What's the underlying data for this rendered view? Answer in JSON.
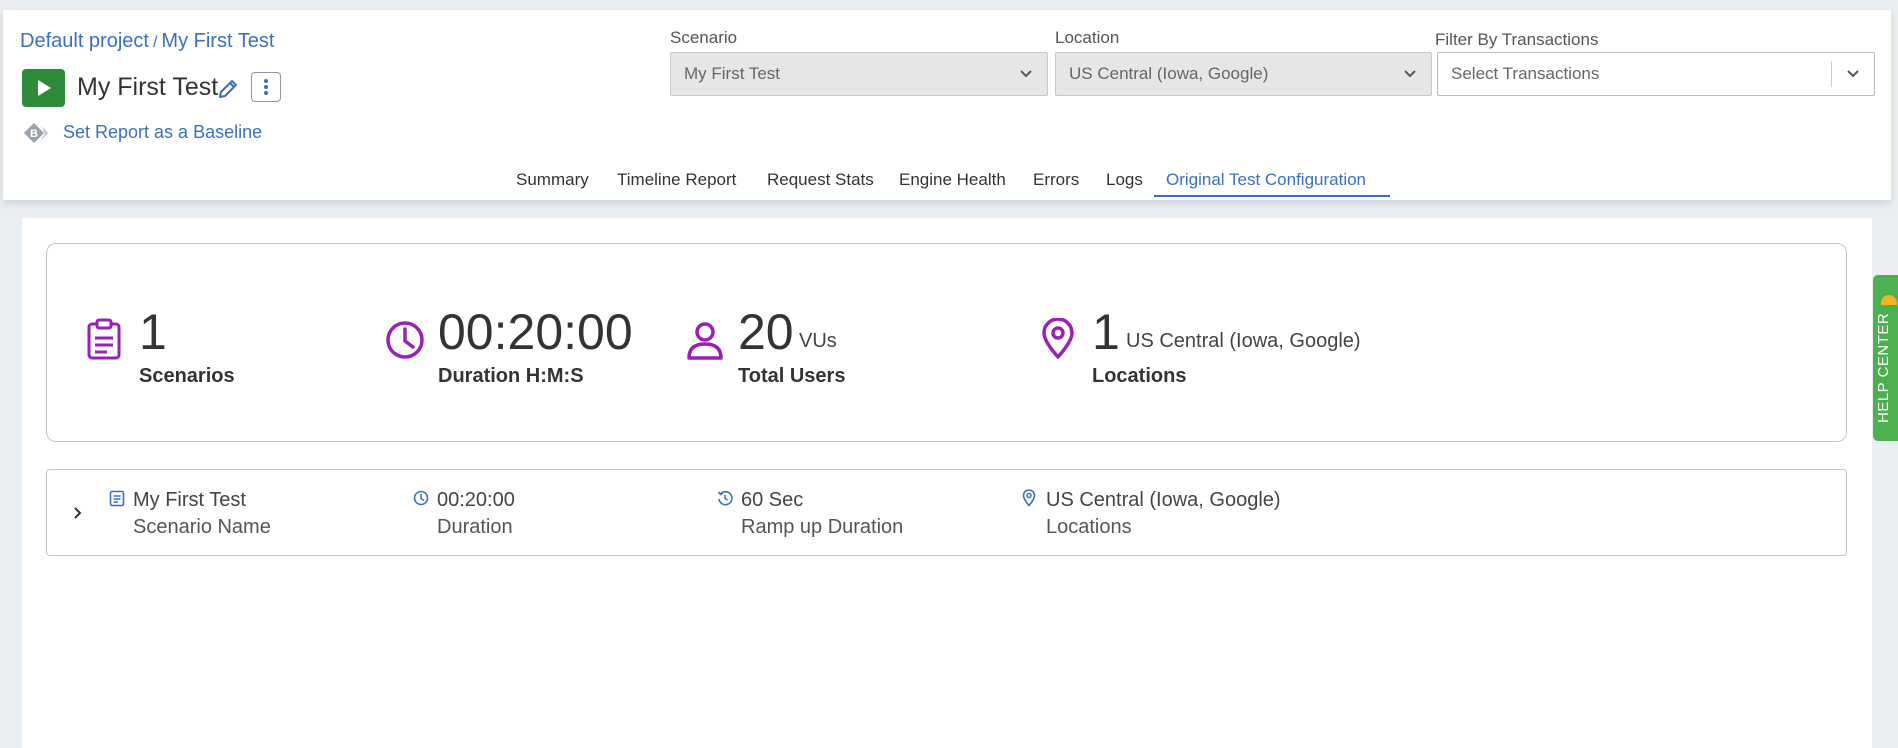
{
  "breadcrumb": {
    "project": "Default project",
    "separator": "/",
    "test": "My First Test"
  },
  "test_title": "My First Test",
  "baseline_link": "Set Report as a Baseline",
  "filters": {
    "scenario": {
      "label": "Scenario",
      "value": "My First Test"
    },
    "location": {
      "label": "Location",
      "value": "US Central (Iowa, Google)"
    },
    "transactions": {
      "label": "Filter By Transactions",
      "placeholder": "Select Transactions"
    }
  },
  "tabs": [
    {
      "label": "Summary"
    },
    {
      "label": "Timeline Report"
    },
    {
      "label": "Request Stats"
    },
    {
      "label": "Engine Health"
    },
    {
      "label": "Errors"
    },
    {
      "label": "Logs"
    },
    {
      "label": "Original Test Configuration"
    }
  ],
  "active_tab": "Original Test Configuration",
  "summary": {
    "scenarios": {
      "value": "1",
      "label": "Scenarios"
    },
    "duration": {
      "value": "00:20:00",
      "label": "Duration H:M:S"
    },
    "users": {
      "value": "20",
      "unit": "VUs",
      "label": "Total Users"
    },
    "locations": {
      "value": "1",
      "unit": "US Central (Iowa, Google)",
      "label": "Locations"
    }
  },
  "scenario_row": {
    "name": {
      "value": "My First Test",
      "label": "Scenario Name"
    },
    "duration": {
      "value": "00:20:00",
      "label": "Duration"
    },
    "ramp_up": {
      "value": "60 Sec",
      "label": "Ramp up Duration"
    },
    "locations": {
      "value": "US Central (Iowa, Google)",
      "label": "Locations"
    }
  },
  "help_center": "HELP CENTER",
  "colors": {
    "accent": "#3b6fc2",
    "run": "#2e8b3a",
    "icon_purple": "#9a1fb8",
    "help": "#4caf50"
  }
}
